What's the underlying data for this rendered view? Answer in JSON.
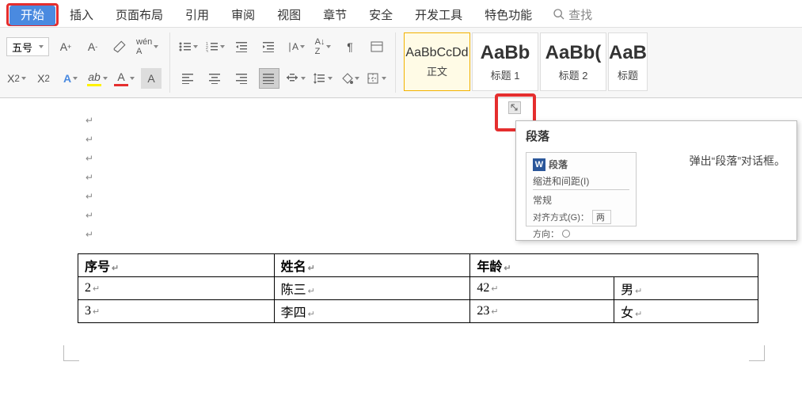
{
  "tabs": {
    "items": [
      {
        "label": "开始",
        "active": true
      },
      {
        "label": "插入"
      },
      {
        "label": "页面布局"
      },
      {
        "label": "引用"
      },
      {
        "label": "审阅"
      },
      {
        "label": "视图"
      },
      {
        "label": "章节"
      },
      {
        "label": "安全"
      },
      {
        "label": "开发工具"
      },
      {
        "label": "特色功能"
      }
    ],
    "search_placeholder": "查找"
  },
  "ribbon": {
    "font_size": "五号",
    "styles": [
      {
        "preview": "AaBbCcDd",
        "name": "正文",
        "selected": true,
        "big": false
      },
      {
        "preview": "AaBb",
        "name": "标题 1",
        "big": true
      },
      {
        "preview": "AaBb(",
        "name": "标题 2",
        "big": true
      },
      {
        "preview": "AaB",
        "name": "标题",
        "big": true,
        "partial": true
      }
    ]
  },
  "tooltip": {
    "title": "段落",
    "desc": "弹出“段落”对话框。",
    "prev_title": "段落",
    "tab1": "缩进和间距(I)",
    "section": "常规",
    "align_label": "对齐方式(G)：",
    "align_value": "两",
    "dir_label": "方向："
  },
  "doc": {
    "headers": [
      "序号",
      "姓名",
      "年龄",
      ""
    ],
    "rows": [
      [
        "2",
        "陈三",
        "42",
        "男"
      ],
      [
        "3",
        "李四",
        "23",
        "女"
      ]
    ]
  }
}
